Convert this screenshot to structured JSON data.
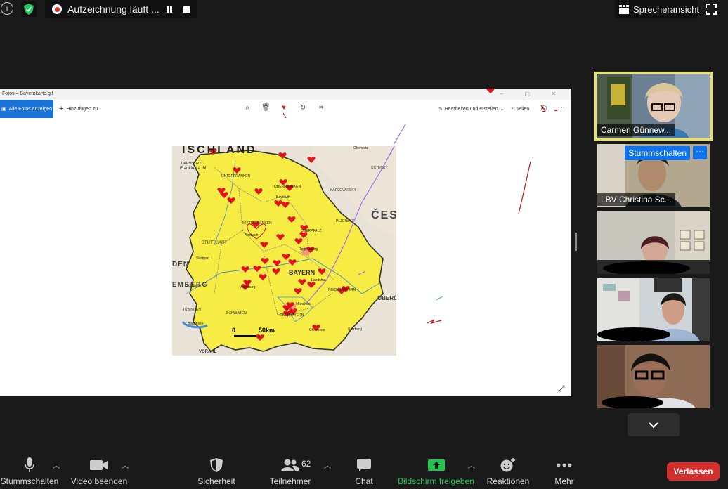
{
  "topbar": {
    "recording_label": "Aufzeichnung läuft ...",
    "speaker_view_label": "Sprecheransicht"
  },
  "shared_window": {
    "title": "Fotos – Bayernkarte.gif",
    "all_photos": "Alle Fotos anzeigen",
    "add_to": "Hinzufügen zu",
    "edit_create": "Bearbeiten und erstellen",
    "share": "Teilen"
  },
  "map": {
    "labels": {
      "top": "ISCHLAND",
      "darmstadt": "DARMSTADT",
      "frankfurt": "Frankfurt a. M.",
      "unterfranken": "UNTERFRANKEN",
      "oberfranken": "OBERFRANKEN",
      "mittelfranken": "MITTELFRANKEN",
      "oberpfalz": "OBERPFALZ",
      "bayern": "BAYERN",
      "niederbayern": "NIEDERBAYERN",
      "oberbayern": "OBERBAYERN",
      "schwaben": "SCHWABEN",
      "stuttgart_region": "STUTTGART",
      "stuttgart": "Stuttgart",
      "tubingen_region": "TÜBINGEN",
      "tubingen": "Tübingen",
      "den": "DEN",
      "emberg": "EMBERG",
      "karlovarsky": "KARLOVARSKÝ",
      "plzensky": "PLZEŇSKÝ",
      "ces": "ČES",
      "obero": "OBERÖ",
      "ustecky": "ÚSTECKÝ",
      "chemnitz": "Chemnitz",
      "bayreuth": "Bayreuth",
      "regensburg": "Regensburg",
      "landshut": "Landshut",
      "ansbach": "Ansbach",
      "augsburg": "Augsburg",
      "munchen": "München",
      "salzburg": "Salzburg",
      "chiemsee": "Chiemsee",
      "bodensee": "Bodensee",
      "vorarl": "VORARL",
      "scale_zero": "0",
      "scale_km": "50km"
    }
  },
  "participants": [
    {
      "name": "Carmen Günnew...",
      "active": true
    },
    {
      "name": "LBV Christina Sc...",
      "mute_label": "Stummschalten",
      "more": "···"
    },
    {
      "name": ""
    },
    {
      "name": ""
    },
    {
      "name": ""
    }
  ],
  "toolbar": {
    "mute": "Stummschalten",
    "video": "Video beenden",
    "security": "Sicherheit",
    "participants": "Teilnehmer",
    "participants_count": "62",
    "chat": "Chat",
    "share_screen": "Bildschirm freigeben",
    "reactions": "Reaktionen",
    "more": "Mehr",
    "leave": "Verlassen"
  },
  "colors": {
    "accent_blue": "#0e72ed",
    "share_green": "#23c552",
    "leave_red": "#d32f2f",
    "active_speaker": "#e7e45a",
    "bavaria_yellow": "#f6ec43",
    "heart_red": "#e0141e"
  }
}
